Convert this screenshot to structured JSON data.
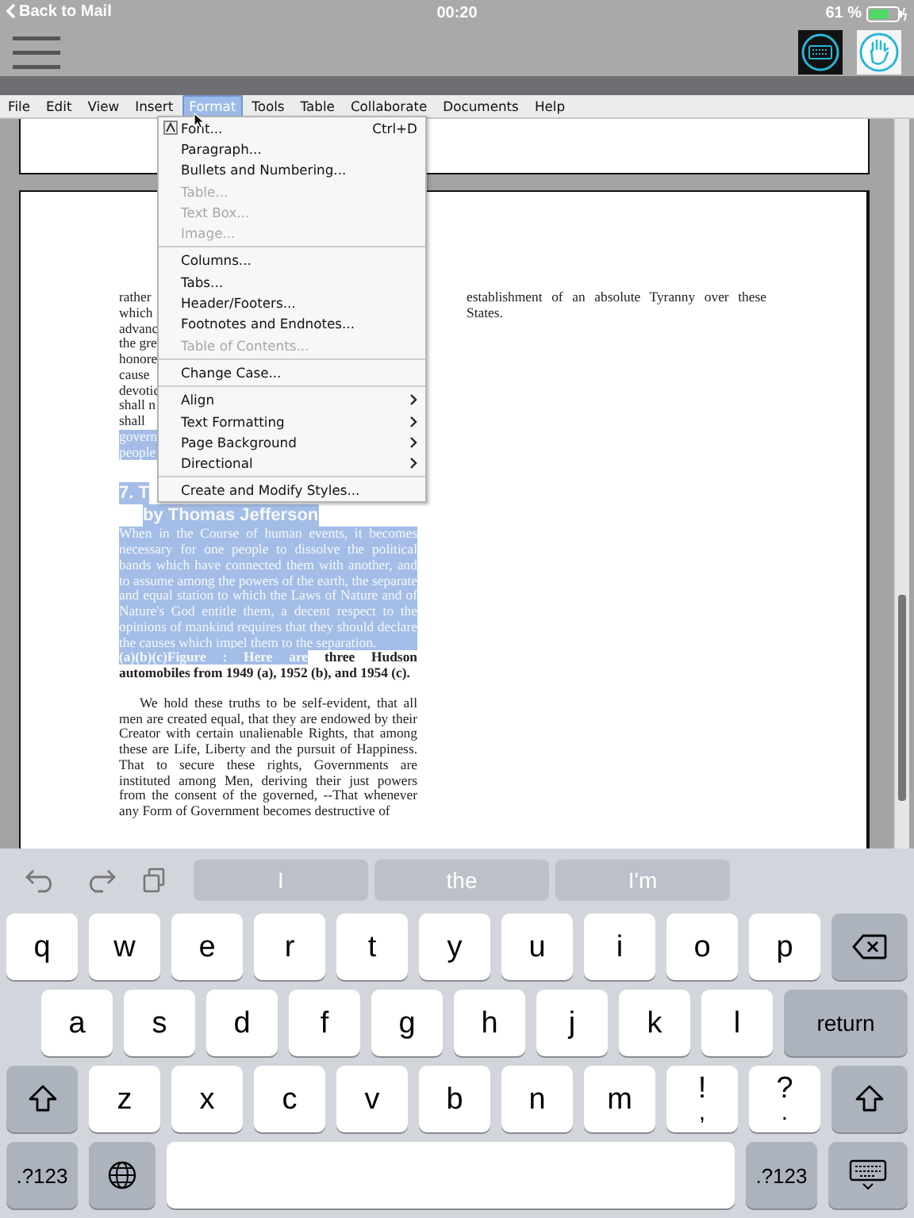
{
  "status_bar": {
    "back": "Back to Mail",
    "time": "00:20",
    "battery": "61 %"
  },
  "menu_bar": [
    {
      "label": "File",
      "selected": false
    },
    {
      "label": "Edit",
      "selected": false
    },
    {
      "label": "View",
      "selected": false
    },
    {
      "label": "Insert",
      "selected": false
    },
    {
      "label": "Format",
      "selected": true
    },
    {
      "label": "Tools",
      "selected": false
    },
    {
      "label": "Table",
      "selected": false
    },
    {
      "label": "Collaborate",
      "selected": false
    },
    {
      "label": "Documents",
      "selected": false
    },
    {
      "label": "Help",
      "selected": false
    }
  ],
  "format_menu": [
    {
      "kind": "icon_item",
      "label": "Font...",
      "shortcut": "Ctrl+D",
      "disabled": false
    },
    {
      "kind": "item",
      "label": "Paragraph...",
      "disabled": false
    },
    {
      "kind": "item",
      "label": "Bullets and Numbering...",
      "disabled": false
    },
    {
      "kind": "item",
      "label": "Table...",
      "disabled": true
    },
    {
      "kind": "item",
      "label": "Text Box...",
      "disabled": true
    },
    {
      "kind": "item",
      "label": "Image...",
      "disabled": true
    },
    {
      "kind": "separator"
    },
    {
      "kind": "item",
      "label": "Columns...",
      "disabled": false
    },
    {
      "kind": "item",
      "label": "Tabs...",
      "disabled": false
    },
    {
      "kind": "item",
      "label": "Header/Footers...",
      "disabled": false
    },
    {
      "kind": "item",
      "label": "Footnotes and Endnotes...",
      "disabled": false
    },
    {
      "kind": "item",
      "label": "Table of Contents...",
      "disabled": true
    },
    {
      "kind": "separator"
    },
    {
      "kind": "item",
      "label": "Change Case...",
      "disabled": false
    },
    {
      "kind": "separator"
    },
    {
      "kind": "submenu",
      "label": "Align",
      "disabled": false
    },
    {
      "kind": "submenu",
      "label": "Text Formatting",
      "disabled": false
    },
    {
      "kind": "submenu",
      "label": "Page Background",
      "disabled": false
    },
    {
      "kind": "submenu",
      "label": "Directional",
      "disabled": false
    },
    {
      "kind": "separator"
    },
    {
      "kind": "item",
      "label": "Create and Modify Styles...",
      "disabled": false
    }
  ],
  "document": {
    "left_column": {
      "fragments": [
        {
          "text": "rather",
          "selected": false
        },
        {
          "text": "which",
          "selected": false
        },
        {
          "text": "advanc",
          "selected": false
        },
        {
          "text": "the gre",
          "selected": false
        },
        {
          "text": "honore",
          "selected": false
        },
        {
          "text": "cause",
          "selected": false
        },
        {
          "text": "devotic",
          "selected": false
        },
        {
          "text": "shall n",
          "selected": false
        },
        {
          "text": "shall",
          "selected": false
        },
        {
          "text": "govern",
          "selected": true
        },
        {
          "text": "people",
          "selected": true
        }
      ],
      "heading": {
        "lines": [
          "7. T",
          "by Thomas Jefferson"
        ],
        "selected": true
      },
      "selected_paragraph": {
        "text": "When in the Course of human events, it becomes necessary for one people to dissolve the political bands which have connected them with another, and to assume among the powers of the earth, the separate and equal station to which the Laws of Nature and of Nature's God entitle them, a decent respect to the opinions of mankind requires that they should declare the causes which impel them to the separation.",
        "selected": true
      },
      "caption": [
        {
          "text": "(a)(b)(c)Figure : Here are",
          "selected": true
        },
        {
          "text": "three Hudson automobiles from 1949 (a), 1952 (b), and 1954 (c).",
          "selected": false
        }
      ],
      "paragraph": {
        "text": "We hold these truths to be self-evident, that all men are created equal, that they are endowed by their Creator with certain unalienable Rights, that among these are Life, Liberty and the pursuit of Happiness. That to secure these rights, Governments are instituted among Men, deriving their just powers from the consent of the governed, --That whenever any Form of Government becomes destructive of",
        "selected": false
      }
    },
    "right_column": {
      "text": "establishment of an absolute Tyranny over these States.",
      "selected": false
    }
  },
  "keyboard": {
    "suggestions": [
      "I",
      "the",
      "I'm"
    ],
    "rows": [
      {
        "keys": [
          {
            "kind": "letter",
            "label": "q"
          },
          {
            "kind": "letter",
            "label": "w"
          },
          {
            "kind": "letter",
            "label": "e"
          },
          {
            "kind": "letter",
            "label": "r"
          },
          {
            "kind": "letter",
            "label": "t"
          },
          {
            "kind": "letter",
            "label": "y"
          },
          {
            "kind": "letter",
            "label": "u"
          },
          {
            "kind": "letter",
            "label": "i"
          },
          {
            "kind": "letter",
            "label": "o"
          },
          {
            "kind": "letter",
            "label": "p"
          },
          {
            "kind": "backspace"
          }
        ]
      },
      {
        "keys": [
          {
            "kind": "letter",
            "label": "a"
          },
          {
            "kind": "letter",
            "label": "s"
          },
          {
            "kind": "letter",
            "label": "d"
          },
          {
            "kind": "letter",
            "label": "f"
          },
          {
            "kind": "letter",
            "label": "g"
          },
          {
            "kind": "letter",
            "label": "h"
          },
          {
            "kind": "letter",
            "label": "j"
          },
          {
            "kind": "letter",
            "label": "k"
          },
          {
            "kind": "letter",
            "label": "l"
          },
          {
            "kind": "return",
            "label": "return"
          }
        ]
      },
      {
        "keys": [
          {
            "kind": "shift"
          },
          {
            "kind": "letter",
            "label": "z"
          },
          {
            "kind": "letter",
            "label": "x"
          },
          {
            "kind": "letter",
            "label": "c"
          },
          {
            "kind": "letter",
            "label": "v"
          },
          {
            "kind": "letter",
            "label": "b"
          },
          {
            "kind": "letter",
            "label": "n"
          },
          {
            "kind": "letter",
            "label": "m"
          },
          {
            "kind": "punct",
            "label": "!",
            "sub": ","
          },
          {
            "kind": "punct",
            "label": "?",
            "sub": "."
          },
          {
            "kind": "shift"
          }
        ]
      },
      {
        "keys": [
          {
            "kind": "mode",
            "label": ".?123"
          },
          {
            "kind": "globe"
          },
          {
            "kind": "space"
          },
          {
            "kind": "mode",
            "label": ".?123"
          },
          {
            "kind": "dismiss"
          }
        ]
      }
    ]
  }
}
